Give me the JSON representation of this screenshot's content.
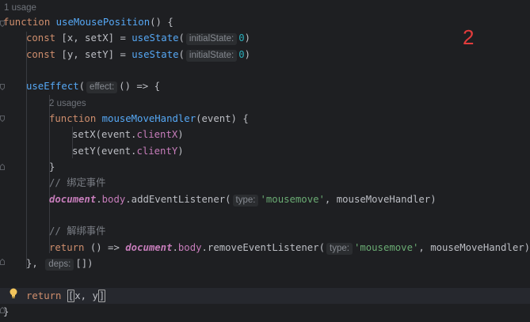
{
  "usage_top": "1 usage",
  "usage_inner": "2 usages",
  "annotation_number": "2",
  "code": {
    "l1_kw": "function",
    "l1_name": "useMousePosition",
    "l1_rest": "() {",
    "l2_kw": "const",
    "l2_decl": " [x, setX] = ",
    "l2_fn": "useState",
    "l2_hint": "initialState:",
    "l2_num": "0",
    "l3_kw": "const",
    "l3_decl": " [y, setY] = ",
    "l3_fn": "useState",
    "l3_hint": "initialState:",
    "l3_num": "0",
    "l5_fn": "useEffect",
    "l5_hint": "effect:",
    "l5_rest": "() => {",
    "l7_kw": "function",
    "l7_name": "mouseMoveHandler",
    "l7_rest": "(event) {",
    "l8_call": "setX(event.",
    "l8_prop": "clientX",
    "l9_call": "setY(event.",
    "l9_prop": "clientY",
    "l10_close": "}",
    "l11_comment": "// 绑定事件",
    "l12_glob": "document",
    "l12_body": "body",
    "l12_method": "addEventListener",
    "l12_hint": "type:",
    "l12_str": "'mousemove'",
    "l12_arg": "mouseMoveHandler",
    "l14_comment": "// 解绑事件",
    "l15_kw": "return",
    "l15_arrow": " () => ",
    "l15_glob": "document",
    "l15_body": "body",
    "l15_method": "removeEventListener",
    "l15_hint": "type:",
    "l15_str": "'mousemove'",
    "l15_arg": "mouseMoveHandler",
    "l16_close": "}, ",
    "l16_hint": "deps:",
    "l16_arr": "[])",
    "l18_kw": "return",
    "l18_arr_open": "[",
    "l18_arr_mid": "x, y",
    "l18_arr_close": "]",
    "l19_close": "}"
  },
  "colors": {
    "background": "#1e1f22",
    "keyword": "#cf8e6d",
    "function": "#56a8f5",
    "number": "#2aacb8",
    "string": "#6aab73",
    "property": "#c77dbb",
    "comment": "#7a7e85",
    "annotation": "#e33c3c"
  },
  "icons": [
    "lightbulb-icon",
    "fold-marker-icon"
  ]
}
